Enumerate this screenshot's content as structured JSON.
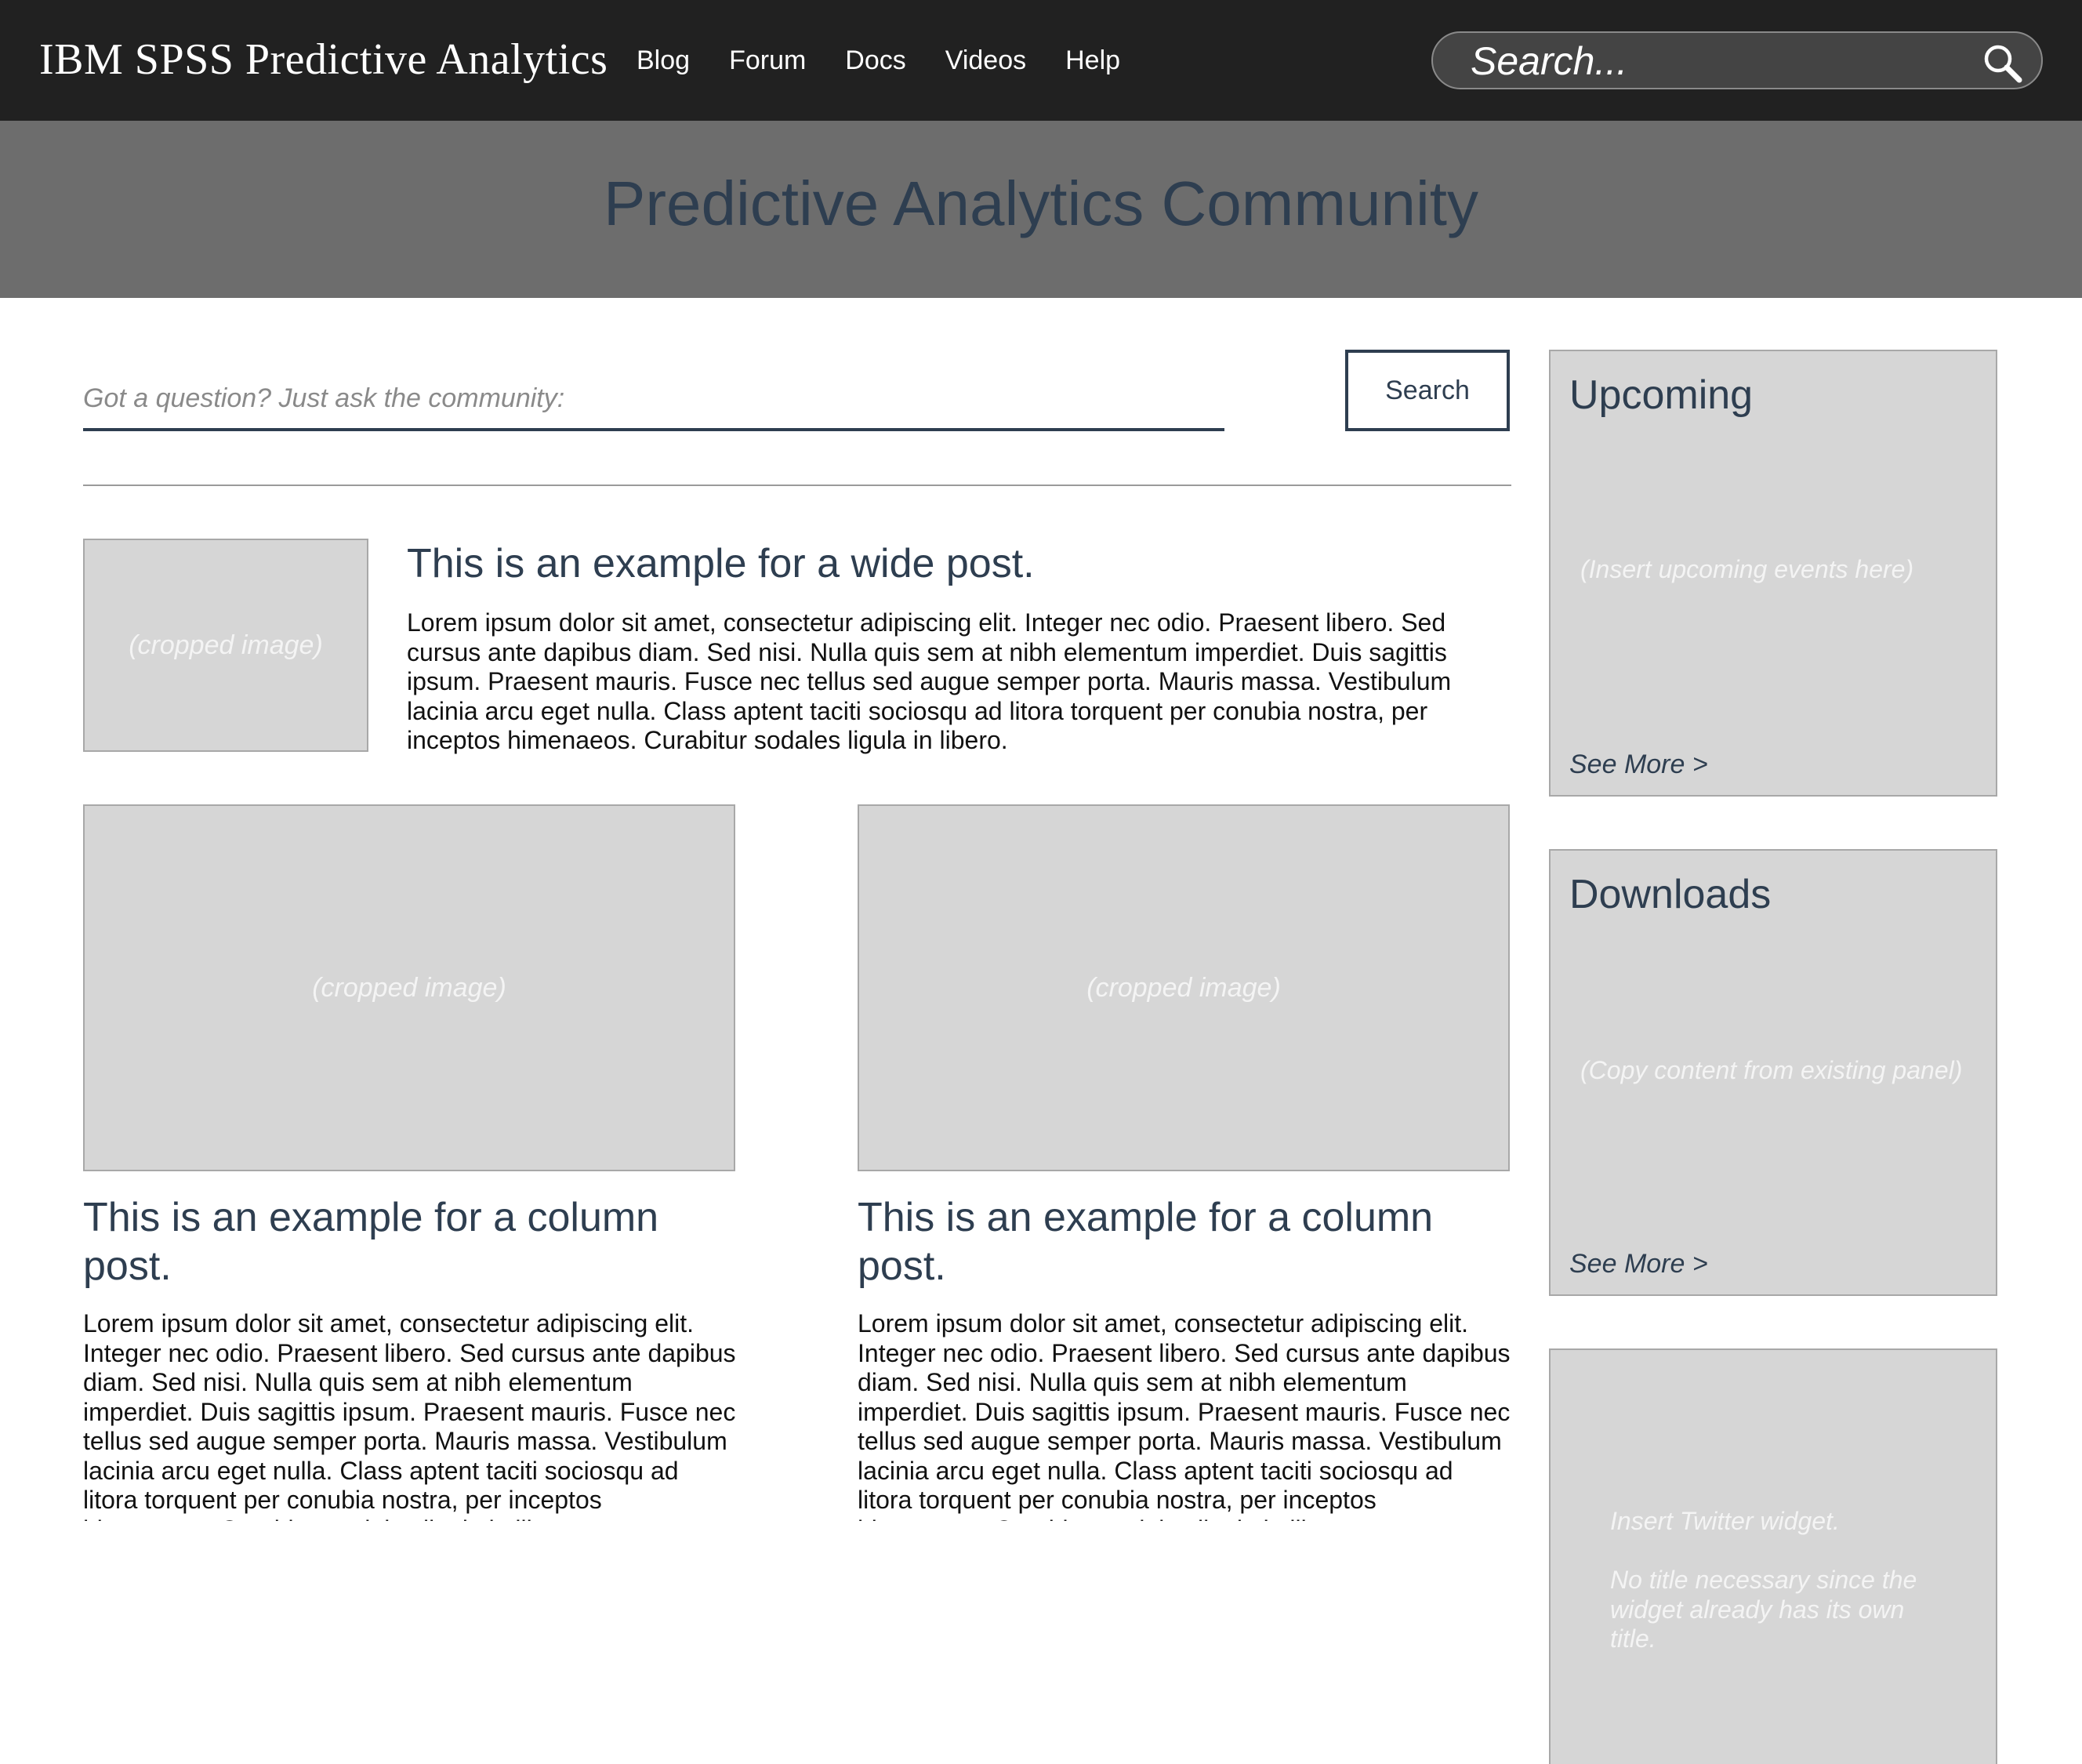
{
  "header": {
    "brand": "IBM SPSS Predictive Analytics",
    "nav": [
      "Blog",
      "Forum",
      "Docs",
      "Videos",
      "Help"
    ],
    "search_placeholder": "Search..."
  },
  "hero": {
    "title": "Predictive Analytics Community"
  },
  "ask": {
    "placeholder": "Got a question? Just ask the community:",
    "button_label": "Search"
  },
  "posts": {
    "wide": {
      "image_label": "(cropped image)",
      "title": "This is an example for a wide post.",
      "body": "Lorem ipsum dolor sit amet, consectetur adipiscing elit. Integer nec odio. Praesent libero. Sed cursus ante dapibus diam. Sed nisi. Nulla quis sem at nibh elementum imperdiet. Duis sagittis ipsum. Praesent mauris. Fusce nec tellus sed augue semper porta. Mauris massa. Vestibulum lacinia arcu eget nulla. Class aptent taciti sociosqu ad litora torquent per conubia nostra, per inceptos himenaeos. Curabitur sodales ligula in libero."
    },
    "columns": [
      {
        "image_label": "(cropped image)",
        "title": "This is an example for a column post.",
        "body": "Lorem ipsum dolor sit amet, consectetur adipiscing elit. Integer nec odio. Praesent libero. Sed cursus ante dapibus diam. Sed nisi. Nulla quis sem at nibh elementum imperdiet. Duis sagittis ipsum. Praesent mauris. Fusce nec tellus sed augue semper porta. Mauris massa. Vestibulum lacinia arcu eget nulla. Class aptent taciti sociosqu ad litora torquent per conubia nostra, per inceptos himenaeos. Curabitur sodales ligula in libero."
      },
      {
        "image_label": "(cropped image)",
        "title": "This is an example for a column post.",
        "body": "Lorem ipsum dolor sit amet, consectetur adipiscing elit. Integer nec odio. Praesent libero. Sed cursus ante dapibus diam. Sed nisi. Nulla quis sem at nibh elementum imperdiet. Duis sagittis ipsum. Praesent mauris. Fusce nec tellus sed augue semper porta. Mauris massa. Vestibulum lacinia arcu eget nulla. Class aptent taciti sociosqu ad litora torquent per conubia nostra, per inceptos himenaeos. Curabitur sodales ligula in libero."
      }
    ]
  },
  "sidebar": {
    "upcoming": {
      "title": "Upcoming",
      "placeholder": "(Insert upcoming events here)",
      "more": "See More >"
    },
    "downloads": {
      "title": "Downloads",
      "placeholder": "(Copy content from existing panel)",
      "more": "See More >"
    },
    "twitter": {
      "line1": "Insert Twitter widget.",
      "line2": "No title necessary since the widget already has its own title."
    }
  },
  "colors": {
    "topbar": "#212121",
    "hero": "#6d6d6d",
    "accent_text": "#2e3e50",
    "placeholder_fill": "#d6d6d6"
  },
  "icons": {
    "search": "search-icon"
  }
}
